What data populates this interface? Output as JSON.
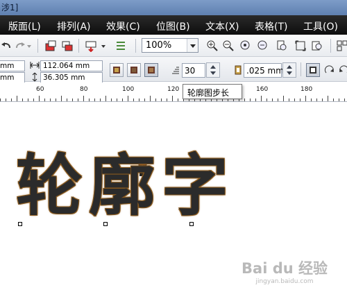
{
  "window": {
    "title": "涉1]"
  },
  "menubar": {
    "items": [
      {
        "label": "版面(L)"
      },
      {
        "label": "排列(A)"
      },
      {
        "label": "效果(C)"
      },
      {
        "label": "位图(B)"
      },
      {
        "label": "文本(X)"
      },
      {
        "label": "表格(T)"
      },
      {
        "label": "工具(O)"
      }
    ]
  },
  "toolbar": {
    "zoom": "100%"
  },
  "propbar": {
    "width": "112.064 mm",
    "height": "36.305 mm",
    "x_unit": "mm",
    "y_unit": "mm",
    "steps": "30",
    "offset": ".025 mm"
  },
  "ruler": {
    "labels": [
      "60",
      "80",
      "100",
      "120",
      "140",
      "160",
      "180"
    ]
  },
  "tooltip": {
    "text": "轮廓图步长"
  },
  "canvas": {
    "text": "轮廓字"
  },
  "watermark": {
    "main": "Bai du 经验",
    "sub": "jingyan.baidu.com"
  },
  "colors": {
    "menubar": "#151515",
    "contour": "#8a5a1e",
    "text_fill": "#2b2b2b"
  },
  "icons": [
    "undo-icon",
    "redo-icon",
    "import-icon",
    "export-icon",
    "publish-icon",
    "zoom-in-icon",
    "zoom-out-icon",
    "zoom-fit-icon"
  ]
}
